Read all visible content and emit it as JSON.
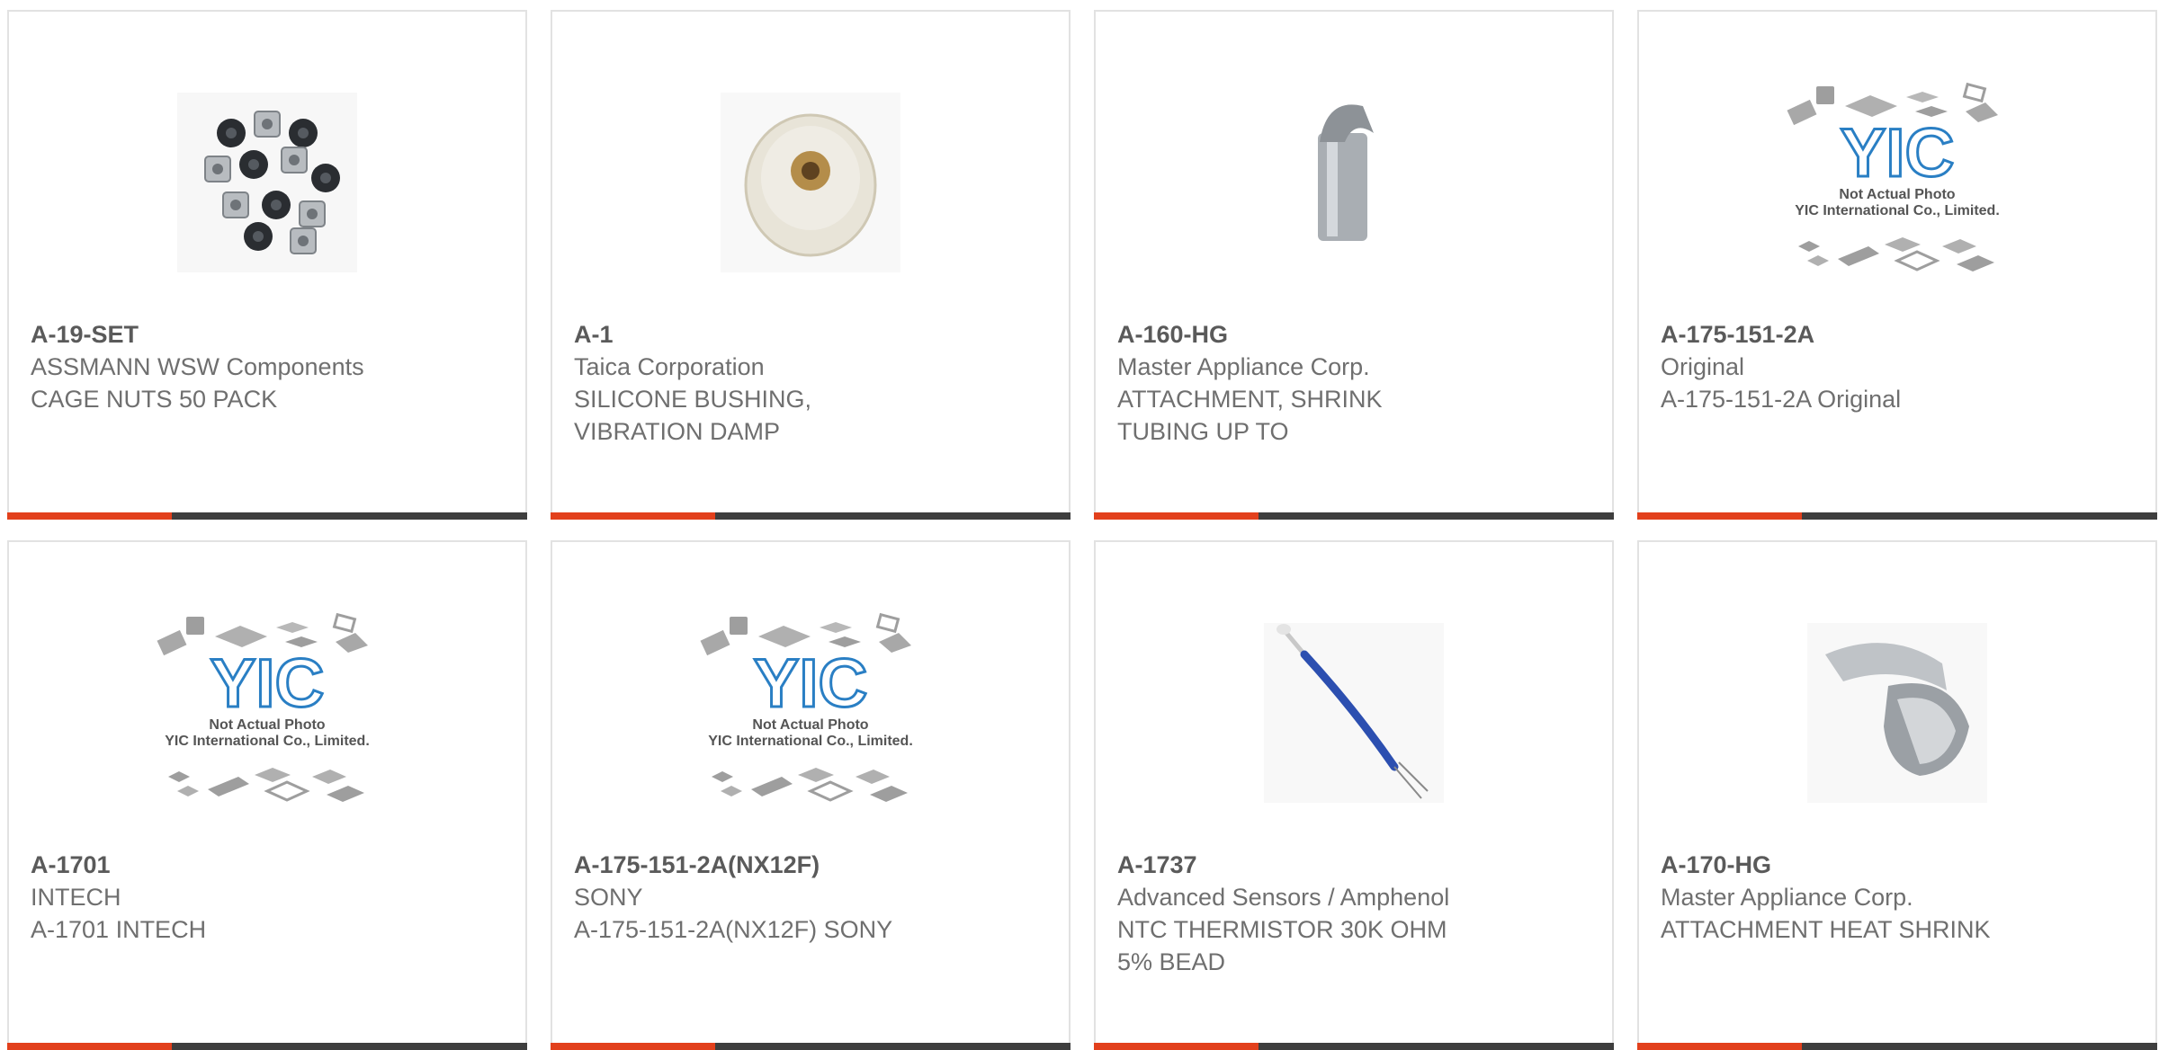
{
  "colors": {
    "accent": "#e2401c",
    "bar_dark": "#3e3e3e",
    "border": "#e2e2e2",
    "text": "#6f6f6f",
    "yic_blue": "#2a7fc4"
  },
  "placeholder": {
    "line1": "Not Actual Photo",
    "line2": "YIC International Co., Limited."
  },
  "products": [
    {
      "part_number": "A-19-SET",
      "manufacturer": "ASSMANN WSW Components",
      "description": [
        "CAGE NUTS 50 PACK"
      ],
      "image": "cage-nuts-photo"
    },
    {
      "part_number": "A-1",
      "manufacturer": "Taica Corporation",
      "description": [
        "SILICONE BUSHING,",
        "VIBRATION DAMP"
      ],
      "image": "silicone-bushing-photo"
    },
    {
      "part_number": "A-160-HG",
      "manufacturer": "Master Appliance Corp.",
      "description": [
        "ATTACHMENT, SHRINK",
        "TUBING UP TO"
      ],
      "image": "shrink-attachment-photo"
    },
    {
      "part_number": "A-175-151-2A",
      "manufacturer": "Original",
      "description": [
        "A-175-151-2A Original"
      ],
      "image": "yic-placeholder"
    },
    {
      "part_number": "A-1701",
      "manufacturer": "INTECH",
      "description": [
        "A-1701 INTECH"
      ],
      "image": "yic-placeholder"
    },
    {
      "part_number": "A-175-151-2A(NX12F)",
      "manufacturer": "SONY",
      "description": [
        "A-175-151-2A(NX12F) SONY"
      ],
      "image": "yic-placeholder"
    },
    {
      "part_number": "A-1737",
      "manufacturer": "Advanced Sensors / Amphenol",
      "description": [
        "NTC THERMISTOR 30K OHM",
        "5% BEAD"
      ],
      "image": "thermistor-photo"
    },
    {
      "part_number": "A-170-HG",
      "manufacturer": "Master Appliance Corp.",
      "description": [
        "ATTACHMENT HEAT SHRINK"
      ],
      "image": "heat-shrink-attachment-photo"
    }
  ]
}
